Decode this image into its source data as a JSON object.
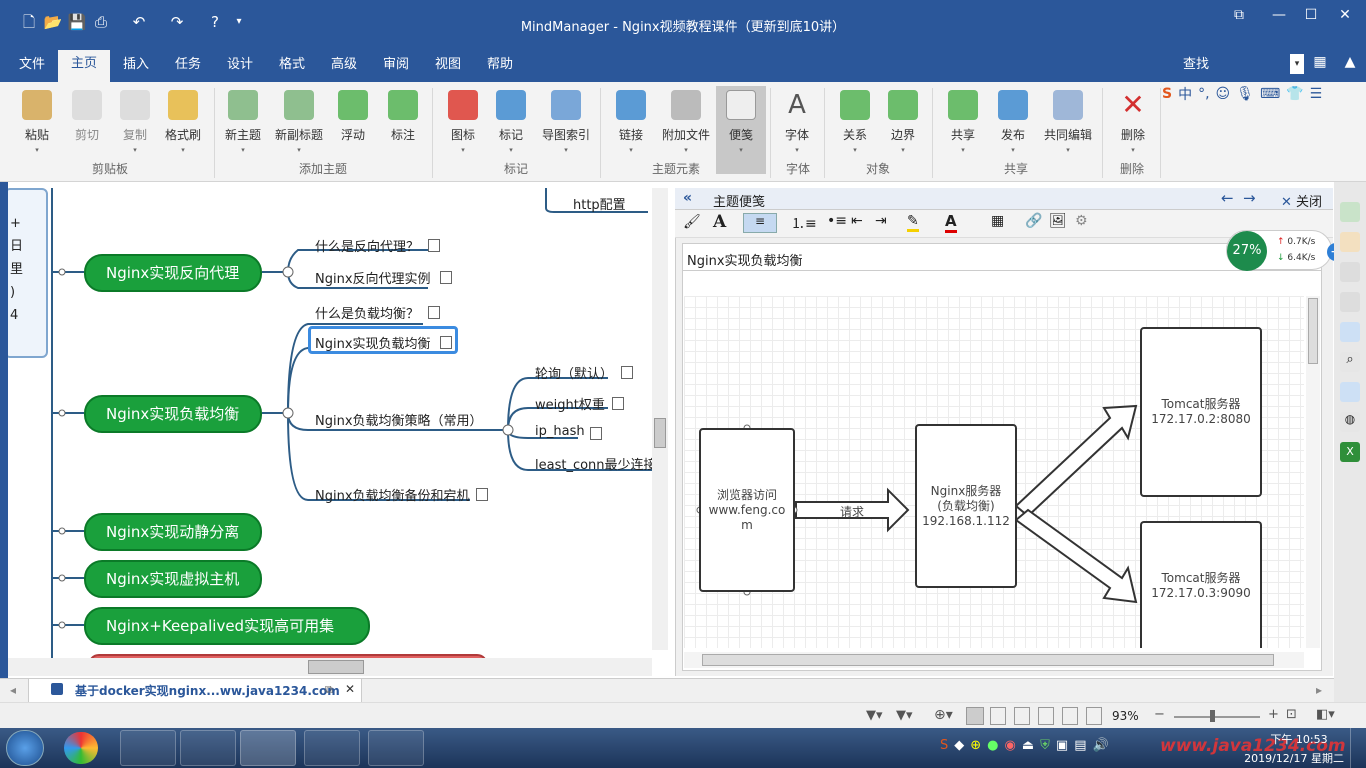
{
  "app": {
    "title": "MindManager - Nginx视频教程课件（更新到底10讲）",
    "find_label": "查找"
  },
  "tabs": [
    "文件",
    "主页",
    "插入",
    "任务",
    "设计",
    "格式",
    "高级",
    "审阅",
    "视图",
    "帮助"
  ],
  "active_tab_index": 1,
  "ribbon": {
    "buttons": [
      {
        "label": "粘贴",
        "icon": "paste-icon"
      },
      {
        "label": "剪切",
        "icon": "cut-icon"
      },
      {
        "label": "复制",
        "icon": "copy-icon"
      },
      {
        "label": "格式刷",
        "icon": "format-painter-icon"
      },
      {
        "label": "新主题",
        "icon": "new-topic-icon"
      },
      {
        "label": "新副标题",
        "icon": "new-subtopic-icon"
      },
      {
        "label": "浮动",
        "icon": "floating-icon"
      },
      {
        "label": "标注",
        "icon": "callout-icon"
      },
      {
        "label": "图标",
        "icon": "icons-icon"
      },
      {
        "label": "标记",
        "icon": "tags-icon"
      },
      {
        "label": "导图索引",
        "icon": "map-index-icon"
      },
      {
        "label": "链接",
        "icon": "link-icon"
      },
      {
        "label": "附加文件",
        "icon": "attach-icon"
      },
      {
        "label": "便笺",
        "icon": "notes-icon"
      },
      {
        "label": "字体",
        "icon": "font-icon"
      },
      {
        "label": "关系",
        "icon": "relationship-icon"
      },
      {
        "label": "边界",
        "icon": "boundary-icon"
      },
      {
        "label": "共享",
        "icon": "share-icon"
      },
      {
        "label": "发布",
        "icon": "publish-icon"
      },
      {
        "label": "共同编辑",
        "icon": "co-edit-icon"
      },
      {
        "label": "删除",
        "icon": "delete-icon"
      }
    ],
    "groups": [
      "剪贴板",
      "添加主题",
      "标记",
      "主题元素",
      "字体",
      "对象",
      "共享",
      "删除"
    ]
  },
  "map": {
    "top_label": "http配置",
    "topics": [
      "Nginx实现反向代理",
      "Nginx实现负载均衡",
      "Nginx实现动静分离",
      "Nginx实现虚拟主机",
      "Nginx+Keepalived实现高可用集群"
    ],
    "subtopics_proxy": [
      "什么是反向代理？",
      "Nginx反向代理实例"
    ],
    "subtopics_lb": [
      "什么是负载均衡？",
      "Nginx实现负载均衡",
      "Nginx负载均衡策略（常用）",
      "Nginx负载均衡备份和宕机"
    ],
    "strategies": [
      "轮询（默认）",
      "weight权重",
      "ip_hash",
      "least_conn最少连接"
    ],
    "left_fragment": "+\n日\n里\n)\n4"
  },
  "notes": {
    "header_title": "主题便笺",
    "close_label": "关闭",
    "heading": "Nginx实现负载均衡",
    "diagram": {
      "browser": "浏览器访问\nwww.feng.co\nm",
      "request": "请求",
      "nginx": "Nginx服务器\n(负载均衡)\n192.168.1.112",
      "tomcat1": "Tomcat服务器\n172.17.0.2:8080",
      "tomcat2": "Tomcat服务器\n172.17.0.3:9090"
    }
  },
  "speed_widget": {
    "percent": "27%",
    "up": "0.7K/s",
    "down": "6.4K/s"
  },
  "doc_tab": "基于docker实现nginx...ww.java1234.com",
  "status": {
    "zoom": "93%"
  },
  "clock": {
    "time": "下午 10:53",
    "date": "2019/12/17 星期二"
  },
  "watermark": "www.java1234.com",
  "colors": {
    "brand": "#2b579a",
    "topic_green": "#1aa03c",
    "delete_red": "#d32f2f"
  }
}
